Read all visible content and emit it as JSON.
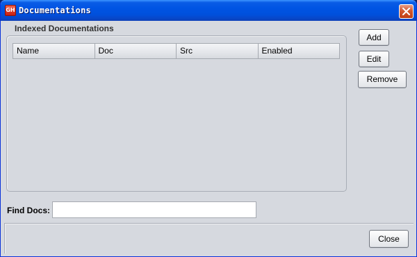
{
  "window": {
    "title": "Documentations",
    "app_icon_text": "GH",
    "close_icon": "close-x-icon"
  },
  "group": {
    "label": "Indexed Documentations"
  },
  "table": {
    "columns": [
      "Name",
      "Doc",
      "Src",
      "Enabled"
    ],
    "rows": []
  },
  "side_buttons": {
    "add_label": "Add",
    "edit_label": "Edit",
    "remove_label": "Remove"
  },
  "find": {
    "label": "Find Docs:",
    "value": ""
  },
  "footer": {
    "close_label": "Close"
  },
  "colors": {
    "titlebar": "#0054e3",
    "close_button": "#d2572f",
    "dialog_background": "#d6d9df"
  }
}
